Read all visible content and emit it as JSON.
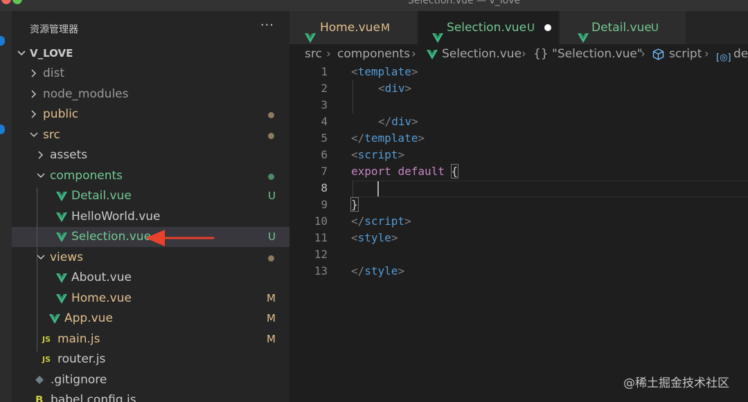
{
  "window": {
    "title": "Selection.vue — v_love"
  },
  "explorer": {
    "header": "资源管理器",
    "more": "···",
    "project": "V_LOVE",
    "items": [
      {
        "label": "dist",
        "kind": "folder",
        "status": "",
        "color": "#9a9a9a"
      },
      {
        "label": "node_modules",
        "kind": "folder",
        "status": "",
        "color": "#9a9a9a"
      },
      {
        "label": "public",
        "kind": "folder",
        "status": "dot",
        "color": "#e2c08d"
      },
      {
        "label": "src",
        "kind": "folder",
        "status": "dot",
        "color": "#e2c08d"
      },
      {
        "label": "assets",
        "kind": "folder",
        "status": "",
        "color": "#cccccc"
      },
      {
        "label": "components",
        "kind": "folder",
        "status": "dot",
        "color": "#73c991"
      },
      {
        "label": "Detail.vue",
        "kind": "vue",
        "status": "U",
        "color": "#73c991"
      },
      {
        "label": "HelloWorld.vue",
        "kind": "vue",
        "status": "",
        "color": "#cccccc"
      },
      {
        "label": "Selection.vue",
        "kind": "vue",
        "status": "U",
        "color": "#73c991"
      },
      {
        "label": "views",
        "kind": "folder",
        "status": "dot",
        "color": "#e2c08d"
      },
      {
        "label": "About.vue",
        "kind": "vue",
        "status": "",
        "color": "#cccccc"
      },
      {
        "label": "Home.vue",
        "kind": "vue",
        "status": "M",
        "color": "#e2c08d"
      },
      {
        "label": "App.vue",
        "kind": "vue",
        "status": "M",
        "color": "#e2c08d"
      },
      {
        "label": "main.js",
        "kind": "js",
        "status": "M",
        "color": "#e2c08d"
      },
      {
        "label": "router.js",
        "kind": "js",
        "status": "",
        "color": "#cccccc"
      },
      {
        "label": ".gitignore",
        "kind": "git",
        "status": "",
        "color": "#cccccc"
      },
      {
        "label": "babel.config.js",
        "kind": "babel",
        "status": "",
        "color": "#cccccc"
      }
    ]
  },
  "tabs": [
    {
      "label": "Home.vue",
      "status": "M",
      "color": "#e2c08d"
    },
    {
      "label": "Selection.vue",
      "status": "U",
      "color": "#73c991"
    },
    {
      "label": "Detail.vue",
      "status": "U",
      "color": "#73c991"
    }
  ],
  "breadcrumb": [
    "src",
    "components",
    "Selection.vue",
    "{} \"Selection.vue\"",
    "script",
    "de"
  ],
  "editor": {
    "line_numbers": [
      "1",
      "2",
      "3",
      "4",
      "5",
      "6",
      "7",
      "8",
      "9",
      "10",
      "11",
      "12",
      "13"
    ],
    "current_line": "8",
    "tokens": {
      "l1_open": "<",
      "l1_tag": "template",
      "l1_close": ">",
      "l2_open": "<",
      "l2_tag": "div",
      "l2_close": ">",
      "l4_open": "</",
      "l4_tag": "div",
      "l4_close": ">",
      "l5_open": "</",
      "l5_tag": "template",
      "l5_close": ">",
      "l6_open": "<",
      "l6_tag": "script",
      "l6_close": ">",
      "l7_kw1": "export",
      "l7_kw2": "default",
      "l7_brace": "{",
      "l9_brace": "}",
      "l10_open": "</",
      "l10_tag": "script",
      "l10_close": ">",
      "l11_open": "<",
      "l11_tag": "style",
      "l11_close": ">",
      "l13_open": "</",
      "l13_tag": "style",
      "l13_close": ">"
    }
  },
  "colors": {
    "vue_icon": "#41b883",
    "js_icon": "#cbcb41",
    "git_status_modified": "#e2c08d",
    "git_status_untracked": "#73c991",
    "annotation_arrow": "#e8412c"
  },
  "watermark": "@稀土掘金技术社区"
}
